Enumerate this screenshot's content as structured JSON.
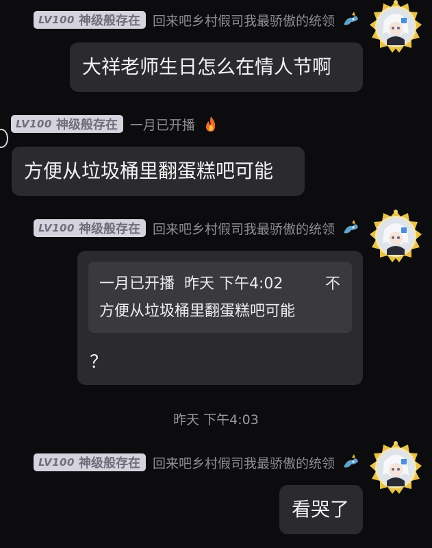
{
  "messages": [
    {
      "level": "LV100",
      "badge_title": "神级般存在",
      "sender_title": "回来吧乡村假司我最骄傲的统领",
      "text": "大祥老师生日怎么在情人节啊"
    },
    {
      "level": "LV100",
      "badge_title": "神级般存在",
      "sender_title": "一月已开播",
      "text": "方便从垃圾桶里翻蛋糕吧可能"
    },
    {
      "level": "LV100",
      "badge_title": "神级般存在",
      "sender_title": "回来吧乡村假司我最骄傲的统领",
      "quote": {
        "author": "一月已开播",
        "time": "昨天 下午4:02",
        "trail": "不",
        "text": "方便从垃圾桶里翻蛋糕吧可能"
      },
      "text": "？"
    },
    {
      "level": "LV100",
      "badge_title": "神级般存在",
      "sender_title": "回来吧乡村假司我最骄傲的统领",
      "text": "看哭了"
    }
  ],
  "timestamp": "昨天 下午4:03",
  "icons": {
    "dragon": "dragon-icon",
    "fire": "fire-icon",
    "avatar": "avatar-medal"
  },
  "colors": {
    "background": "#0c0c0e",
    "bubble": "#2b2b2f",
    "quote": "#3a3a3e",
    "badge": "#d5d4de",
    "medal_gold": "#e8c14a"
  }
}
